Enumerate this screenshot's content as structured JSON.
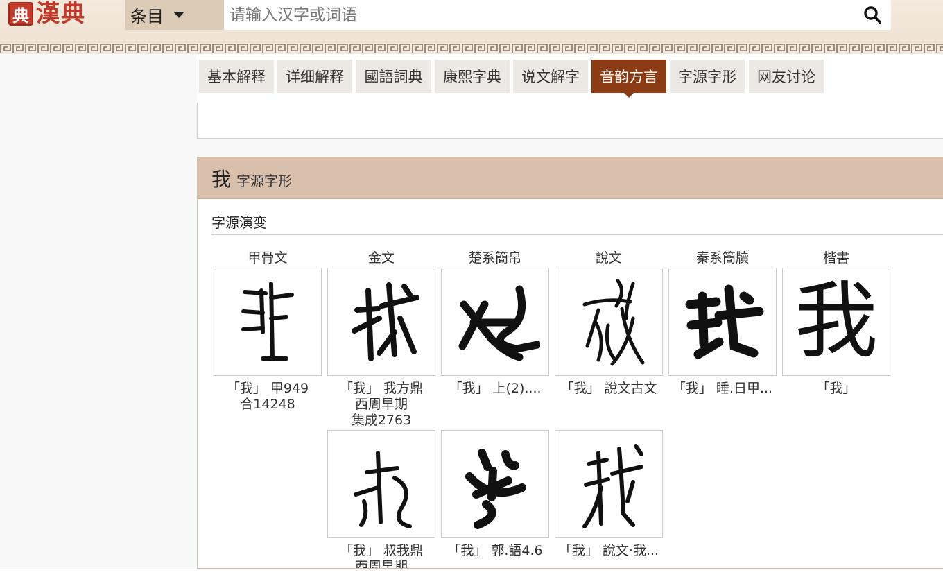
{
  "header": {
    "logo_text": "漢典",
    "logo_seal": "典",
    "category_label": "条目",
    "search_placeholder": "请输入汉字或词语",
    "search_icon": "search-icon"
  },
  "tabs": [
    {
      "label": "基本解释",
      "active": false
    },
    {
      "label": "详细解释",
      "active": false
    },
    {
      "label": "國語詞典",
      "active": false
    },
    {
      "label": "康熙字典",
      "active": false
    },
    {
      "label": "说文解字",
      "active": false
    },
    {
      "label": "音韵方言",
      "active": true
    },
    {
      "label": "字源字形",
      "active": false
    },
    {
      "label": "网友讨论",
      "active": false
    }
  ],
  "panel": {
    "char": "我",
    "title": "字源字形",
    "section": "字源演变",
    "columns": [
      "甲骨文",
      "金文",
      "楚系簡帛",
      "說文",
      "秦系簡牘",
      "楷書"
    ],
    "row1": [
      {
        "lines": [
          "「我」 甲949",
          "合14248"
        ]
      },
      {
        "lines": [
          "「我」 我方鼎",
          "西周早期",
          "集成2763"
        ]
      },
      {
        "lines": [
          "「我」 上(2)...."
        ]
      },
      {
        "lines": [
          "「我」 說文古文"
        ]
      },
      {
        "lines": [
          "「我」 睡.日甲..."
        ]
      },
      {
        "lines": [
          "「我」"
        ]
      }
    ],
    "row2": [
      {
        "lines": [
          "「我」 叔我鼎",
          "西周早期"
        ]
      },
      {
        "lines": [
          "「我」 郭.語4.6"
        ]
      },
      {
        "lines": [
          "「我」 說文·我..."
        ]
      }
    ],
    "kaishu_char": "我"
  },
  "colors": {
    "header_bg": "#f4e9dd",
    "accent": "#8b3c14",
    "logo_red": "#c23a2a",
    "panel_head": "#d9c0ac"
  }
}
